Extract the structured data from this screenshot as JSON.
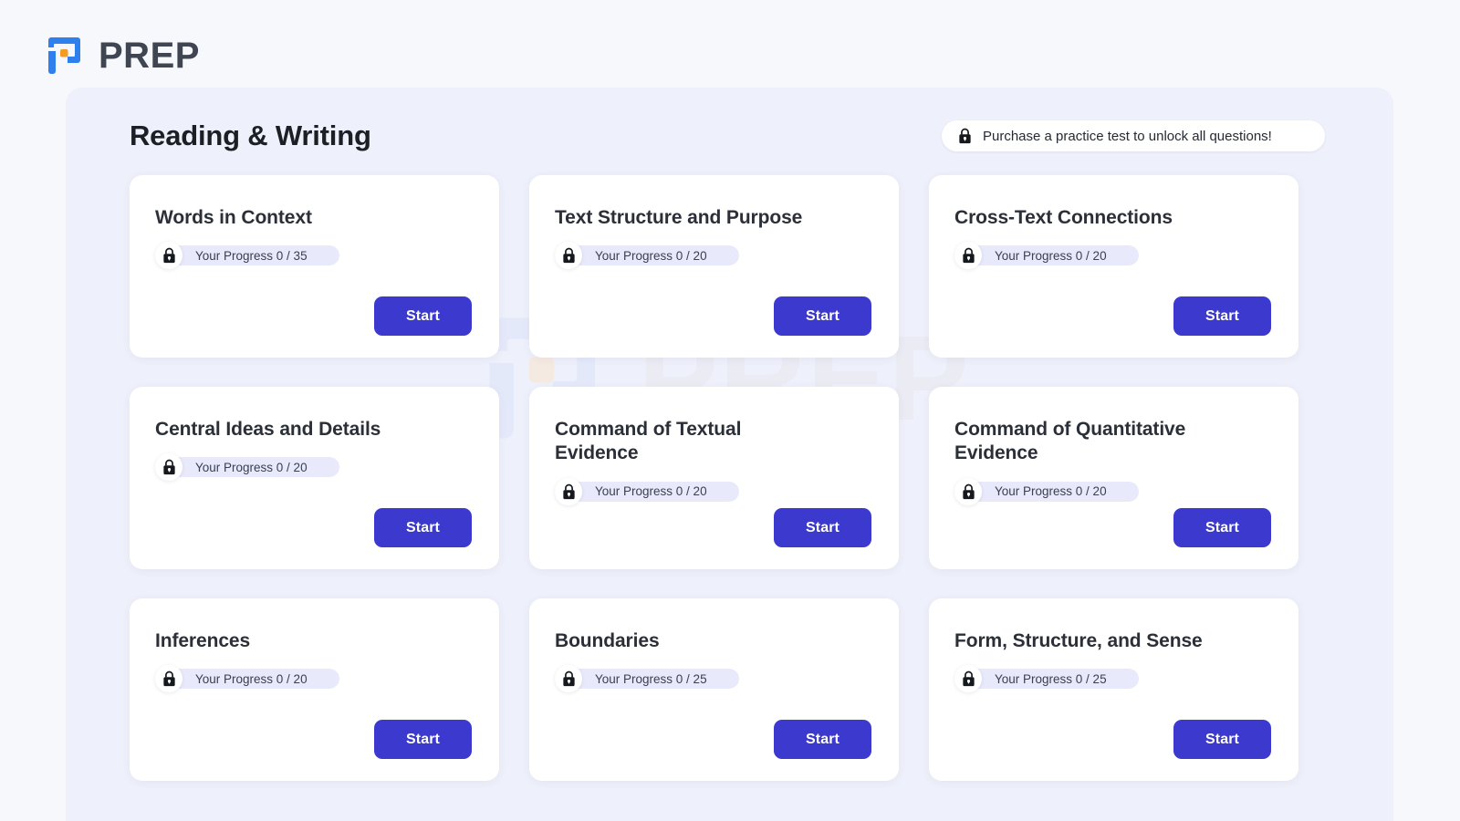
{
  "brand": {
    "word": "PREP",
    "mark_icon": "prep-logo-icon"
  },
  "watermark": {
    "word": "PREP",
    "mark_icon": "prep-logo-watermark-icon"
  },
  "header": {
    "title": "Reading & Writing",
    "banner": {
      "icon": "lock-icon",
      "text": "Purchase a practice test to unlock all questions!"
    }
  },
  "colors": {
    "page_background": "#f7f8fc",
    "panel_background": "#eef0fb",
    "card_background": "#ffffff",
    "start_button": "#3c39cf",
    "progress_pill": "#e8eafb",
    "title_text": "#1c2024",
    "brand_blue": "#2f80ed",
    "brand_orange": "#f59b1f"
  },
  "common": {
    "start_label": "Start",
    "lock_icon": "lock-icon"
  },
  "cards": [
    {
      "title": "Words in Context",
      "progress": "Your Progress 0 / 35",
      "completed": 0,
      "total": 35,
      "locked": true,
      "start_label": "Start"
    },
    {
      "title": "Text Structure and Purpose",
      "progress": "Your Progress 0 / 20",
      "completed": 0,
      "total": 20,
      "locked": true,
      "start_label": "Start"
    },
    {
      "title": "Cross-Text Connections",
      "progress": "Your Progress 0 / 20",
      "completed": 0,
      "total": 20,
      "locked": true,
      "start_label": "Start"
    },
    {
      "title": "Central Ideas and Details",
      "progress": "Your Progress 0 / 20",
      "completed": 0,
      "total": 20,
      "locked": true,
      "start_label": "Start"
    },
    {
      "title": "Command of Textual Evidence",
      "progress": "Your Progress 0 / 20",
      "completed": 0,
      "total": 20,
      "locked": true,
      "start_label": "Start"
    },
    {
      "title": "Command of Quantitative Evidence",
      "progress": "Your Progress 0 / 20",
      "completed": 0,
      "total": 20,
      "locked": true,
      "start_label": "Start"
    },
    {
      "title": "Inferences",
      "progress": "Your Progress 0 / 20",
      "completed": 0,
      "total": 20,
      "locked": true,
      "start_label": "Start"
    },
    {
      "title": "Boundaries",
      "progress": "Your Progress 0 / 25",
      "completed": 0,
      "total": 25,
      "locked": true,
      "start_label": "Start"
    },
    {
      "title": "Form, Structure, and Sense",
      "progress": "Your Progress 0 / 25",
      "completed": 0,
      "total": 25,
      "locked": true,
      "start_label": "Start"
    }
  ]
}
